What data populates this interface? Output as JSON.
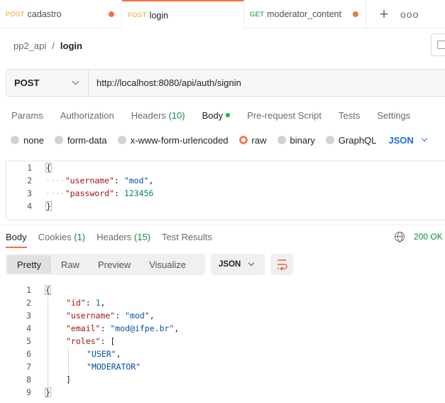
{
  "tabs": [
    {
      "method": "POST",
      "name": "cadastro",
      "method_color": "#e8a623"
    },
    {
      "method": "POST",
      "name": "login",
      "method_color": "#e8a623"
    },
    {
      "method": "GET",
      "name": "moderator_content",
      "method_color": "#0b8e3f"
    }
  ],
  "tab_actions": {
    "new_tab": "+",
    "more": "ooo"
  },
  "breadcrumb": {
    "collection": "pp2_api",
    "separator": "/",
    "request": "login"
  },
  "request": {
    "method": "POST",
    "url": "http://localhost:8080/api/auth/signin"
  },
  "request_tabs": [
    {
      "label": "Params"
    },
    {
      "label": "Authorization"
    },
    {
      "label": "Headers",
      "count": "(10)"
    },
    {
      "label": "Body"
    },
    {
      "label": "Pre-request Script"
    },
    {
      "label": "Tests"
    },
    {
      "label": "Settings"
    }
  ],
  "body_types": [
    "none",
    "form-data",
    "x-www-form-urlencoded",
    "raw",
    "binary",
    "GraphQL"
  ],
  "body_type_selected": "raw",
  "body_format": "JSON",
  "request_body_lines": {
    "line_numbers": [
      "1",
      "2",
      "3",
      "4"
    ],
    "open": "{",
    "username_key": "\"username\"",
    "username_val": "\"mod\"",
    "password_key": "\"password\"",
    "password_val": "123456",
    "close": "}"
  },
  "response_tabs": [
    {
      "label": "Body"
    },
    {
      "label": "Cookies",
      "count": "(1)"
    },
    {
      "label": "Headers",
      "count": "(15)"
    },
    {
      "label": "Test Results"
    }
  ],
  "status": "200 OK",
  "view_modes": [
    "Pretty",
    "Raw",
    "Preview",
    "Visualize"
  ],
  "response_format": "JSON",
  "response_body": {
    "line_numbers": [
      "1",
      "2",
      "3",
      "4",
      "5",
      "6",
      "7",
      "8",
      "9"
    ],
    "open": "{",
    "id_key": "\"id\"",
    "id_val": "1",
    "username_key": "\"username\"",
    "username_val": "\"mod\"",
    "email_key": "\"email\"",
    "email_val": "\"mod@ifpe.br\"",
    "roles_key": "\"roles\"",
    "roles_open": "[",
    "role_1": "\"USER\"",
    "role_2": "\"MODERATOR\"",
    "roles_close": "]",
    "close": "}"
  },
  "colors": {
    "accent": "#ff6c37",
    "success": "#0b8e3f",
    "link": "#1d6fd4"
  }
}
